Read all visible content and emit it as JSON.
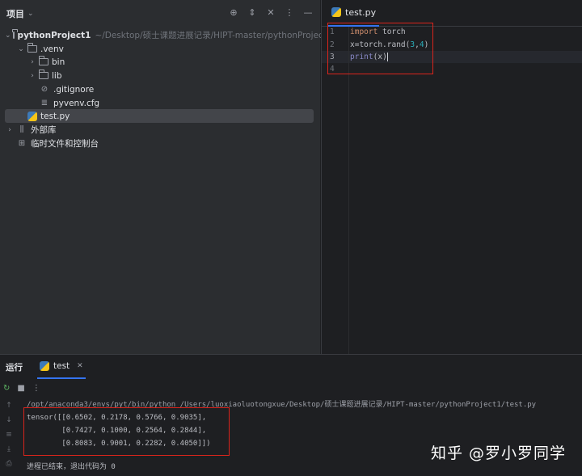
{
  "project_panel": {
    "title": "项目",
    "tree": [
      {
        "name": "pythonProject1",
        "path": "~/Desktop/硕士课题进展记录/HIPT-master/pythonProject1"
      },
      {
        "name": ".venv"
      },
      {
        "name": "bin"
      },
      {
        "name": "lib"
      },
      {
        "name": ".gitignore"
      },
      {
        "name": "pyvenv.cfg"
      },
      {
        "name": "test.py"
      },
      {
        "name": "外部库"
      },
      {
        "name": "临时文件和控制台"
      }
    ]
  },
  "editor": {
    "tab_label": "test.py",
    "line_numbers": [
      "1",
      "2",
      "3",
      "4"
    ],
    "code": {
      "l1_kw": "import",
      "l1_rest": " torch",
      "l2_a": "x=torch.rand(",
      "l2_n1": "3",
      "l2_sep": ",",
      "l2_n2": "4",
      "l2_end": ")",
      "l3_fn": "print",
      "l3_a": "(x",
      "l3_b": ")"
    }
  },
  "run": {
    "panel_label": "运行",
    "tab_label": "test",
    "console": [
      "/opt/anaconda3/envs/pyt/bin/python /Users/luoxiaoluotongxue/Desktop/硕士课题进展记录/HIPT-master/pythonProject1/test.py",
      "tensor([[0.6502, 0.2178, 0.5766, 0.9035],",
      "        [0.7427, 0.1000, 0.2564, 0.2844],",
      "        [0.8083, 0.9001, 0.2282, 0.4050]])",
      "进程已结束，退出代码为 0"
    ]
  },
  "watermark": "知乎 @罗小罗同学",
  "colors": {
    "highlight_box": "#d9241c",
    "accent": "#3574f0"
  }
}
